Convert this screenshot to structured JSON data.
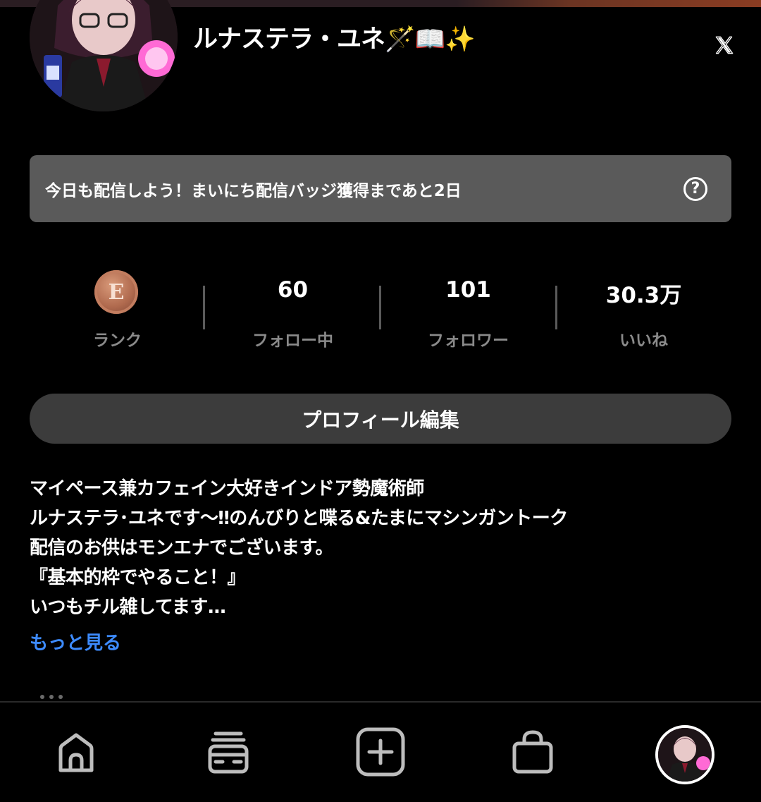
{
  "profile": {
    "username": "ルナステラ・ユネ🪄📖✨"
  },
  "header": {
    "x_icon": "x-logo-icon"
  },
  "banner": {
    "text": "今日も配信しよう！まいにち配信バッジ獲得まであと2日",
    "help_icon": "question-circle-icon",
    "help_glyph": "?"
  },
  "stats": {
    "rank": {
      "badge_letter": "E",
      "label": "ランク"
    },
    "following": {
      "value": "60",
      "label": "フォロー中"
    },
    "followers": {
      "value": "101",
      "label": "フォロワー"
    },
    "likes": {
      "value": "30.3万",
      "label": "いいね"
    }
  },
  "edit_button": {
    "label": "プロフィール編集"
  },
  "bio": {
    "lines": [
      "マイペース兼カフェイン大好きインドア勢魔術師",
      "ルナステラ･ユネです〜‼︎のんびりと喋る&たまにマシンガントーク",
      "配信のお供はモンエナでございます。",
      "『基本的枠でやること！』",
      "いつもチル雑してます…"
    ],
    "more_label": "もっと見る"
  },
  "bottom_nav": {
    "items": [
      {
        "icon": "home-icon"
      },
      {
        "icon": "feed-icon"
      },
      {
        "icon": "add-icon"
      },
      {
        "icon": "shop-icon"
      },
      {
        "icon": "profile-avatar"
      }
    ]
  },
  "colors": {
    "background": "#000000",
    "banner": "#5a5a5a",
    "button": "#3c3c3c",
    "link": "#3d8bff",
    "muted_label": "#8a8a8a",
    "rank_bronze": "#b06a4e"
  }
}
